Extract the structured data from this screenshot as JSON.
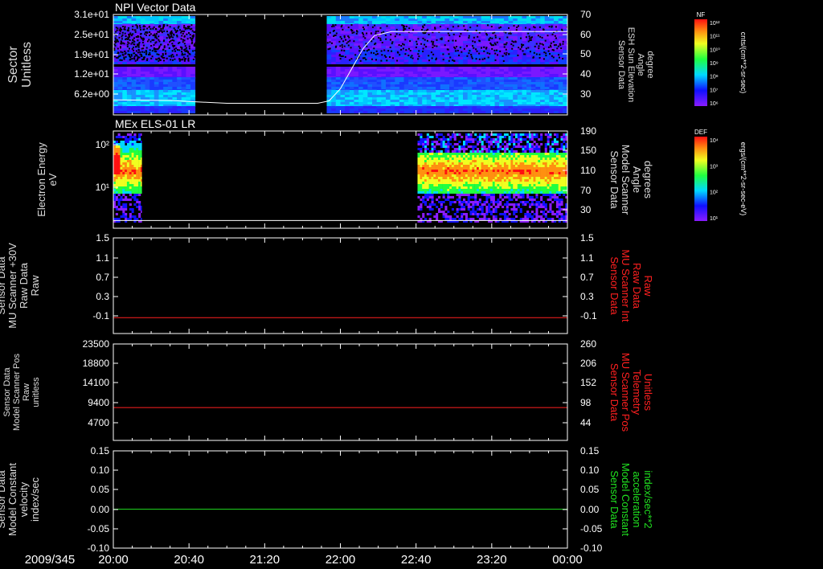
{
  "panels": [
    {
      "title": "NPI Vector Data",
      "left_label": [
        "Sector",
        "Unitless"
      ],
      "left_color": "#dddddd",
      "right_label": [
        "Sensor Data",
        "ESH Sun Elevation",
        "Angle",
        "degree"
      ],
      "right_color": "#dddddd",
      "left_ticks": [
        "3.1e+01",
        "2.5e+01",
        "1.9e+01",
        "1.2e+01",
        "6.2e+00"
      ],
      "right_ticks": [
        "70",
        "60",
        "50",
        "40",
        "30"
      ],
      "colorbar": {
        "label": "NF",
        "unit": "cnts/(cm**2-sr-sec)",
        "ticks": [
          "10¹²",
          "10¹¹",
          "10¹⁰",
          "10⁹",
          "10⁸",
          "10⁷",
          "10⁶"
        ]
      }
    },
    {
      "title": "MEx ELS-01 LR",
      "left_label": [
        "Electron Energy",
        "eV"
      ],
      "left_color": "#dddddd",
      "right_label": [
        "Sensor Data",
        "Model Scanner",
        "Angle",
        "degrees"
      ],
      "right_color": "#dddddd",
      "left_ticks": [
        "10²",
        "10¹"
      ],
      "right_ticks": [
        "190",
        "150",
        "110",
        "70",
        "30"
      ],
      "colorbar": {
        "label": "DEF",
        "unit": "ergs/(cm**2-sr-sec-eV)",
        "ticks": [
          "10⁴",
          "10³",
          "10²",
          "10¹"
        ]
      }
    },
    {
      "title": "",
      "left_label": [
        "Sensor Data",
        "MU Scanner +30V",
        "Raw Data",
        "Raw"
      ],
      "left_color": "#dddddd",
      "right_label": [
        "Sensor Data",
        "MU Scanner Int",
        "Raw Data",
        "Raw"
      ],
      "right_color": "#ff2020",
      "left_ticks": [
        "1.5",
        "1.1",
        "0.7",
        "0.3",
        "-0.1"
      ],
      "right_ticks": [
        "1.5",
        "1.1",
        "0.7",
        "0.3",
        "-0.1"
      ]
    },
    {
      "title": "",
      "left_label": [
        "Sensor Data",
        "Model Scanner Pos",
        "Raw",
        "unitless"
      ],
      "left_color": "#dddddd",
      "right_label": [
        "Sensor Data",
        "MU Scanner Pos",
        "Telemetry",
        "Unitless"
      ],
      "right_color": "#ff2020",
      "left_ticks": [
        "23500",
        "18800",
        "14100",
        "9400",
        "4700"
      ],
      "right_ticks": [
        "260",
        "206",
        "152",
        "98",
        "44"
      ]
    },
    {
      "title": "",
      "left_label": [
        "Sensor Data",
        "Model Constant",
        "velocity",
        "index/sec"
      ],
      "left_color": "#dddddd",
      "right_label": [
        "Sensor Data",
        "Model Constant",
        "acceleration",
        "index/sec**2"
      ],
      "right_color": "#20e020",
      "left_ticks": [
        "0.15",
        "0.10",
        "0.05",
        "0.00",
        "-0.05",
        "-0.10"
      ],
      "right_ticks": [
        "0.15",
        "0.10",
        "0.05",
        "0.00",
        "-0.05",
        "-0.10"
      ]
    }
  ],
  "time_axis": {
    "date": "2009/345",
    "ticks": [
      "20:00",
      "20:40",
      "21:20",
      "22:00",
      "22:40",
      "23:20",
      "00:00"
    ]
  },
  "colors": {
    "background": "#000000",
    "frame": "#ffffff",
    "line_white": "#ffffff",
    "line_red": "#ff2020",
    "line_green": "#20e020"
  },
  "chart_data": [
    {
      "type": "heatmap",
      "title": "NPI Vector Data",
      "xlabel": "",
      "ylabel": "Sector Unitless",
      "x_ticks": [
        "20:00",
        "20:40",
        "21:20",
        "22:00",
        "22:40",
        "23:20",
        "00:00"
      ],
      "y_ticks": [
        31,
        25,
        19,
        12,
        6.2
      ],
      "data_gaps_hours": [
        [
          20.72,
          21.88
        ]
      ],
      "overlay_line": {
        "name": "Sensor Data ESH Sun Elevation Angle",
        "y2lim": [
          20,
          70
        ],
        "x_hours": [
          20.0,
          20.5,
          20.7,
          21.0,
          21.4,
          21.8,
          21.9,
          22.0,
          22.1,
          22.2,
          22.3,
          22.45,
          22.6,
          23.0,
          23.5,
          24.0
        ],
        "y_values": [
          27.5,
          27.2,
          26.6,
          25.8,
          25.8,
          25.8,
          27,
          33,
          43,
          53,
          59.5,
          61.5,
          61.5,
          61.5,
          61.5,
          61.5
        ]
      }
    },
    {
      "type": "heatmap",
      "title": "MEx ELS-01 LR",
      "ylabel": "Electron Energy eV",
      "x_ticks": [
        "20:00",
        "20:40",
        "21:20",
        "22:00",
        "22:40",
        "23:20",
        "00:00"
      ],
      "y_ticks": [
        "10²",
        "10¹"
      ],
      "y_scale": "log",
      "data_gaps_hours": [
        [
          20.25,
          22.68
        ]
      ],
      "overlay_line": {
        "name": "Sensor Data Model Scanner Angle",
        "y2lim": [
          0,
          190
        ],
        "x_hours": [
          20.0,
          24.0
        ],
        "y_values": [
          15,
          15
        ]
      }
    },
    {
      "type": "line",
      "ylabel": "Sensor Data MU Scanner +30V Raw Data Raw",
      "ylim": [
        -0.3,
        1.5
      ],
      "series": [
        {
          "name": "Sensor Data MU Scanner Int Raw Data Raw",
          "color": "#ff2020",
          "x_hours": [
            20.0,
            24.0
          ],
          "values": [
            0.0,
            0.0
          ]
        }
      ]
    },
    {
      "type": "line",
      "ylabel": "Sensor Data Model Scanner Pos Raw unitless",
      "ylim": [
        0,
        23500
      ],
      "y2lim": [
        0,
        260
      ],
      "series": [
        {
          "name": "Sensor Data MU Scanner Pos Telemetry Unitless",
          "color": "#ff2020",
          "x_hours": [
            20.0,
            24.0
          ],
          "values": [
            8000,
            8000
          ]
        }
      ]
    },
    {
      "type": "line",
      "ylabel": "Sensor Data Model Constant velocity index/sec",
      "ylim": [
        -0.1,
        0.15
      ],
      "series": [
        {
          "name": "Sensor Data Model Constant acceleration index/sec**2",
          "color": "#20e020",
          "x_hours": [
            20.0,
            24.0
          ],
          "values": [
            0.0,
            0.0
          ]
        }
      ]
    }
  ]
}
